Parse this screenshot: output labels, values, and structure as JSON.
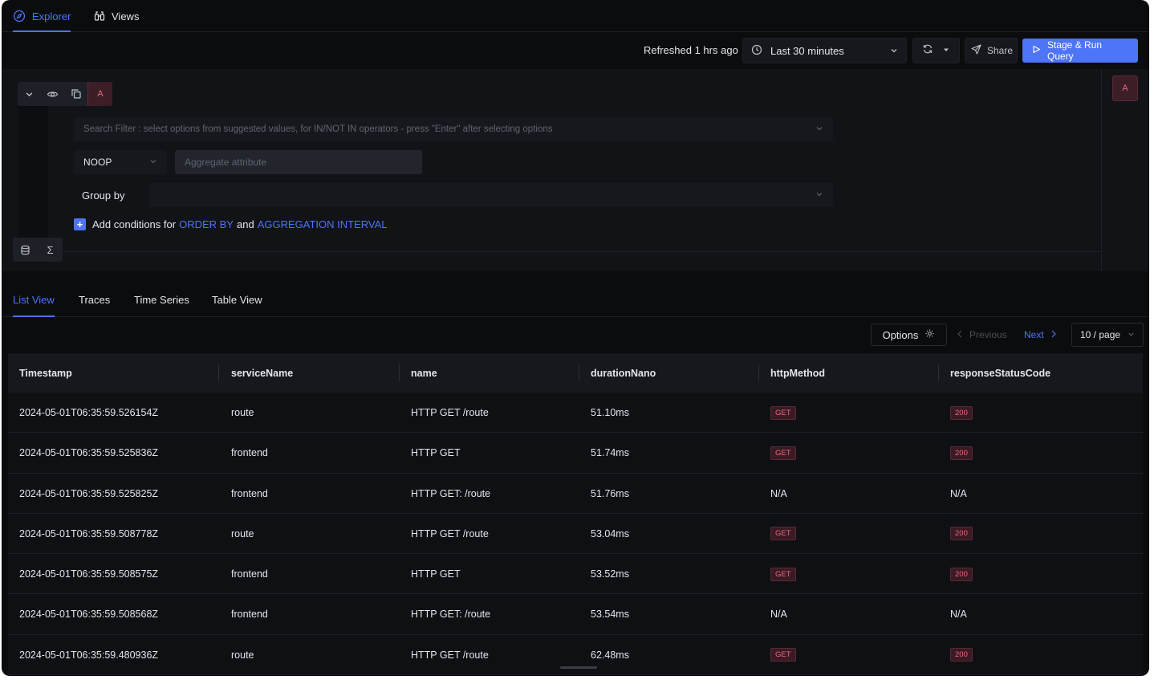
{
  "nav": {
    "tabs": [
      {
        "label": "Explorer",
        "icon": "compass-icon"
      },
      {
        "label": "Views",
        "icon": "binoculars-icon"
      }
    ]
  },
  "toolbar": {
    "refreshed_text": "Refreshed 1 hrs ago",
    "time_range": "Last 30 minutes",
    "share_label": "Share",
    "run_label": "Stage & Run Query"
  },
  "query": {
    "badge": "A",
    "side_badge": "A",
    "search_placeholder": "Search Filter : select options from suggested values, for IN/NOT IN operators - press \"Enter\" after selecting options",
    "aggregate_operator": "NOOP",
    "aggregate_attr_placeholder": "Aggregate attribute",
    "group_by_label": "Group by",
    "add_conditions_prefix": "Add conditions for",
    "order_by": "ORDER BY",
    "and_text": "and",
    "aggregation_interval": "AGGREGATION INTERVAL",
    "sigma": "Σ"
  },
  "views": {
    "tabs": [
      "List View",
      "Traces",
      "Time Series",
      "Table View"
    ],
    "active": "List View"
  },
  "pagination": {
    "options_label": "Options",
    "previous_label": "Previous",
    "next_label": "Next",
    "page_size": "10 / page"
  },
  "table": {
    "columns": [
      "Timestamp",
      "serviceName",
      "name",
      "durationNano",
      "httpMethod",
      "responseStatusCode"
    ],
    "rows": [
      {
        "timestamp": "2024-05-01T06:35:59.526154Z",
        "service": "route",
        "name": "HTTP GET /route",
        "duration": "51.10ms",
        "method": "GET",
        "status": "200"
      },
      {
        "timestamp": "2024-05-01T06:35:59.525836Z",
        "service": "frontend",
        "name": "HTTP GET",
        "duration": "51.74ms",
        "method": "GET",
        "status": "200"
      },
      {
        "timestamp": "2024-05-01T06:35:59.525825Z",
        "service": "frontend",
        "name": "HTTP GET: /route",
        "duration": "51.76ms",
        "method": "N/A",
        "status": "N/A"
      },
      {
        "timestamp": "2024-05-01T06:35:59.508778Z",
        "service": "route",
        "name": "HTTP GET /route",
        "duration": "53.04ms",
        "method": "GET",
        "status": "200"
      },
      {
        "timestamp": "2024-05-01T06:35:59.508575Z",
        "service": "frontend",
        "name": "HTTP GET",
        "duration": "53.52ms",
        "method": "GET",
        "status": "200"
      },
      {
        "timestamp": "2024-05-01T06:35:59.508568Z",
        "service": "frontend",
        "name": "HTTP GET: /route",
        "duration": "53.54ms",
        "method": "N/A",
        "status": "N/A"
      },
      {
        "timestamp": "2024-05-01T06:35:59.480936Z",
        "service": "route",
        "name": "HTTP GET /route",
        "duration": "62.48ms",
        "method": "GET",
        "status": "200"
      }
    ]
  },
  "colors": {
    "accent": "#4e74f8",
    "background": "#0b0c0e",
    "badge_pink": "#e76a85"
  }
}
